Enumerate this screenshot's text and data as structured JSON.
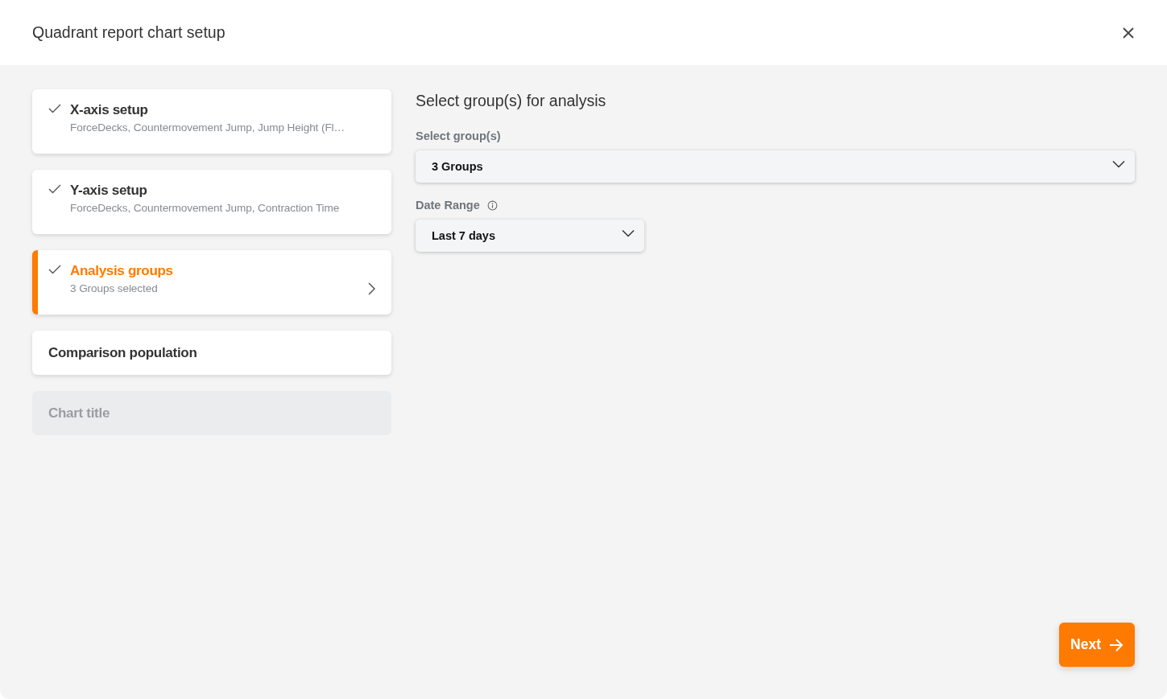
{
  "dialog": {
    "title": "Quadrant report chart setup"
  },
  "steps": [
    {
      "title": "X-axis setup",
      "subtitle": "ForceDecks, Countermovement Jump, Jump Height (Fl…",
      "completed": true,
      "selected": false,
      "disabled": false
    },
    {
      "title": "Y-axis setup",
      "subtitle": "ForceDecks, Countermovement Jump, Contraction Time",
      "completed": true,
      "selected": false,
      "disabled": false
    },
    {
      "title": "Analysis groups",
      "subtitle": "3 Groups selected",
      "completed": true,
      "selected": true,
      "disabled": false
    },
    {
      "title": "Comparison population",
      "completed": false,
      "selected": false,
      "disabled": false
    },
    {
      "title": "Chart title",
      "completed": false,
      "selected": false,
      "disabled": true
    }
  ],
  "panel": {
    "heading": "Select group(s) for analysis",
    "fields": [
      {
        "label": "Select group(s)",
        "value": "3 Groups",
        "info": false,
        "wide": true
      },
      {
        "label": "Date Range",
        "value": "Last 7 days",
        "info": true,
        "wide": false
      }
    ]
  },
  "next_button": {
    "label": "Next"
  }
}
